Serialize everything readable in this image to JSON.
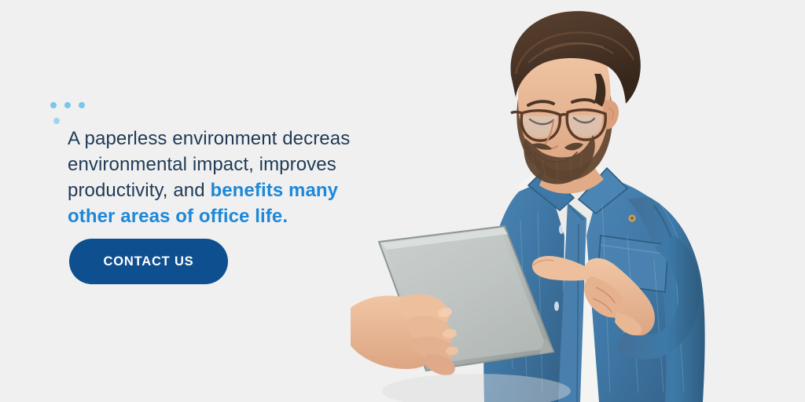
{
  "banner": {
    "background_color": "#f0f0f0",
    "accent_blue": "#1e88d8",
    "dot_blue": "#79c3e8",
    "navy": "#1f3a56",
    "button_color": "#0d4f8f"
  },
  "copy": {
    "line1": "A paperless environment decreases",
    "line2": "environmental impact, improves",
    "line3_plain": "productivity, and ",
    "line3_highlight": "benefits many",
    "line4_highlight": "other areas of office life."
  },
  "cta": {
    "label": "CONTACT US"
  },
  "decorations": {
    "accent_dot_cluster": "four-dot-cluster",
    "dotted_frame": "dotted-square-frame"
  },
  "photo": {
    "alt": "Smiling bearded man with glasses in a denim shirt tapping a silver tablet",
    "skin": "#e8b894",
    "hair": "#4a3527",
    "denim": "#417aa8",
    "tshirt": "#f2f2f0",
    "tablet": "#b9bfbd"
  }
}
